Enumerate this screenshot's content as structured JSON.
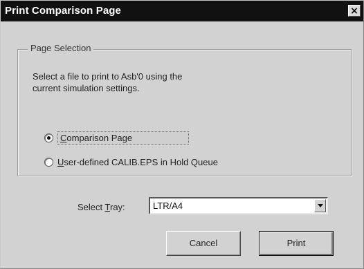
{
  "window": {
    "title": "Print Comparison Page",
    "close_glyph": "×",
    "close_icon": "close-icon"
  },
  "page_selection": {
    "legend": "Page Selection",
    "instruction_line1": "Select a file to print to  Asb'0  using the",
    "instruction_line2": "current simulation settings.",
    "options": [
      {
        "label_underlined": "C",
        "label_rest": "omparison Page",
        "selected": true
      },
      {
        "label_underlined": "U",
        "label_rest": "ser-defined CALIB.EPS in Hold Queue",
        "selected": false
      }
    ]
  },
  "tray": {
    "label_start": "Select ",
    "label_underlined": "T",
    "label_end": "ray:",
    "value": "LTR/A4"
  },
  "buttons": {
    "cancel_label": "Cancel",
    "print_label": "Print"
  }
}
